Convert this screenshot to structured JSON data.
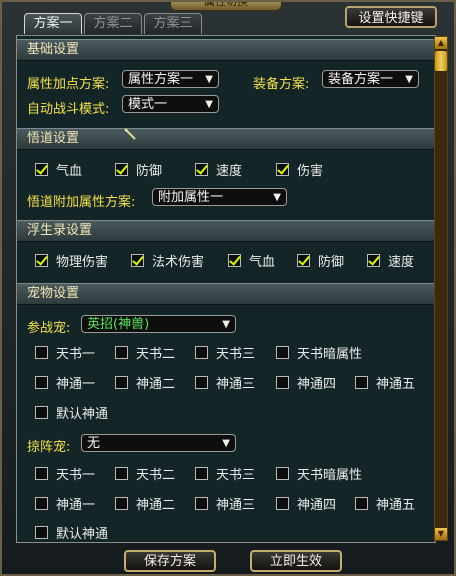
{
  "window": {
    "title": "属性切换"
  },
  "tabs": [
    {
      "label": "方案一"
    },
    {
      "label": "方案二"
    },
    {
      "label": "方案三"
    }
  ],
  "shortcut_button": "设置快捷键",
  "basic": {
    "title": "基础设置",
    "attr_label": "属性加点方案:",
    "attr_value": "属性方案一",
    "equip_label": "装备方案:",
    "equip_value": "装备方案一",
    "battle_label": "自动战斗模式:",
    "battle_value": "模式一"
  },
  "insight": {
    "title": "悟道设置",
    "checks": [
      {
        "label": "气血",
        "checked": true
      },
      {
        "label": "防御",
        "checked": true
      },
      {
        "label": "速度",
        "checked": true
      },
      {
        "label": "伤害",
        "checked": true
      }
    ],
    "extra_label": "悟道附加属性方案:",
    "extra_value": "附加属性一"
  },
  "fusheng": {
    "title": "浮生录设置",
    "checks": [
      {
        "label": "物理伤害",
        "checked": true
      },
      {
        "label": "法术伤害",
        "checked": true
      },
      {
        "label": "气血",
        "checked": true
      },
      {
        "label": "防御",
        "checked": true
      },
      {
        "label": "速度",
        "checked": true
      }
    ]
  },
  "pet": {
    "title": "宠物设置",
    "battle_label": "参战宠:",
    "battle_value": "英招(神兽)",
    "row1": [
      "天书一",
      "天书二",
      "天书三",
      "天书暗属性"
    ],
    "row2": [
      "神通一",
      "神通二",
      "神通三",
      "神通四",
      "神通五"
    ],
    "row3": [
      "默认神通"
    ],
    "formation_label": "掠阵宠:",
    "formation_value": "无",
    "row4": [
      "天书一",
      "天书二",
      "天书三",
      "天书暗属性"
    ],
    "row5": [
      "神通一",
      "神通二",
      "神通三",
      "神通四",
      "神通五"
    ],
    "row6": [
      "默认神通"
    ]
  },
  "buttons": {
    "save": "保存方案",
    "apply": "立即生效"
  },
  "icons": {
    "dropdown": "dropdown-arrow-icon",
    "check": "check-icon"
  },
  "colors": {
    "label_yellow": "#f2e04a",
    "check_green": "#d2ff00",
    "pet_green": "#58e858",
    "gold": "#c5ad6c"
  }
}
